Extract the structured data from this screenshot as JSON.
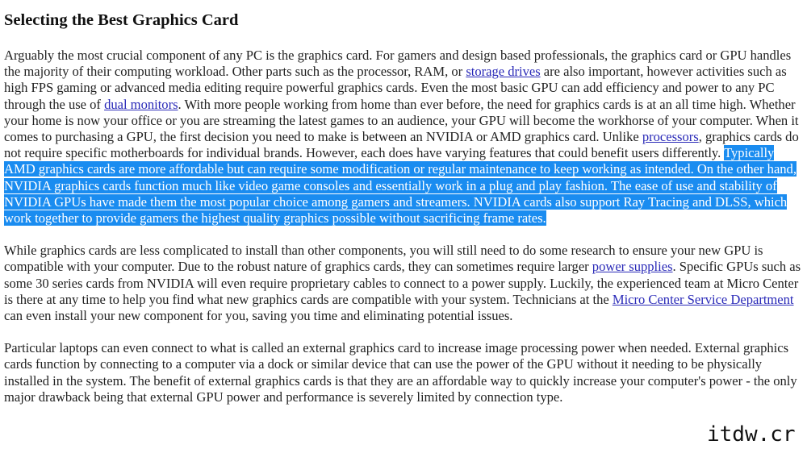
{
  "article": {
    "title": "Selecting the Best Graphics Card",
    "paragraph1": {
      "t1": "Arguably the most crucial component of any PC is the graphics card. For gamers and design based professionals, the graphics card or GPU handles the majority of their computing workload. Other parts such as the processor, RAM, or ",
      "link_storage": "storage drives",
      "t2": " are also important, however activities such as high FPS gaming or advanced media editing require powerful graphics cards. Even the most basic GPU can add efficiency and power to any PC through the use of ",
      "link_dual_monitors": "dual monitors",
      "t3": ". With more people working from home than ever before, the need for graphics cards is at an all time high. Whether your home is now your office or you are streaming the latest games to an audience, your GPU will become the workhorse of your computer. When it comes to purchasing a GPU, the first decision you need to make is between an NVIDIA or AMD graphics card. Unlike ",
      "link_processors": "processors",
      "t4": ", graphics cards do not require specific motherboards for individual brands. However, each does have varying features that could benefit users differently. ",
      "selected_text": "Typically AMD graphics cards are more affordable but can require some modification or regular maintenance to keep working as intended. On the other hand, NVIDIA graphics cards function much like video game consoles and essentially work in a plug and play fashion. The ease of use and stability of NVIDIA GPUs have made them the most popular choice among gamers and streamers. NVIDIA cards also support Ray Tracing and DLSS, which work together to provide gamers the highest quality graphics possible without sacrificing frame rates."
    },
    "paragraph2": {
      "t1": "While graphics cards are less complicated to install than other components, you will still need to do some research to ensure your new GPU is compatible with your computer. Due to the robust nature of graphics cards, they can sometimes require larger ",
      "link_power_supplies": "power supplies",
      "t2": ". Specific GPUs such as some 30 series cards from NVIDIA will even require proprietary cables to connect to a power supply. Luckily, the experienced team at Micro Center is there at any time to help you find what new graphics cards are compatible with your system. Technicians at the ",
      "link_service_dept": "Micro Center Service Department",
      "t3": " can even install your new component for you, saving you time and eliminating potential issues."
    },
    "paragraph3": {
      "t1": "Particular laptops can even connect to what is called an external graphics card to increase image processing power when needed. External graphics cards function by connecting to a computer via a dock or similar device that can use the power of the GPU without it needing to be physically installed in the system. The benefit of external graphics cards is that they are an affordable way to quickly increase your computer's power - the only major drawback being that external GPU power and performance is severely limited by connection type."
    }
  },
  "watermark": "itdw.cr",
  "colors": {
    "selection_background": "#1a8cf0",
    "selection_text": "#ffffff",
    "link": "#2a2ab8",
    "text": "#222222"
  }
}
